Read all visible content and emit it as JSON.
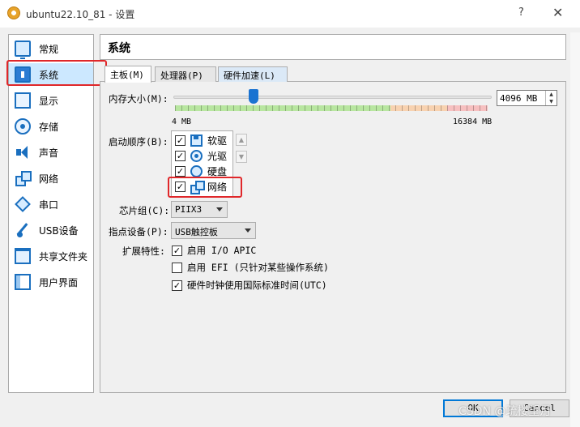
{
  "window": {
    "title": "ubuntu22.10_81 - 设置",
    "help_glyph": "?",
    "close_glyph": "✕"
  },
  "sidebar": {
    "items": [
      {
        "label": "常规",
        "icon": "general-icon"
      },
      {
        "label": "系统",
        "icon": "system-icon"
      },
      {
        "label": "显示",
        "icon": "display-icon"
      },
      {
        "label": "存储",
        "icon": "storage-icon"
      },
      {
        "label": "声音",
        "icon": "audio-icon"
      },
      {
        "label": "网络",
        "icon": "network-icon"
      },
      {
        "label": "串口",
        "icon": "serial-port-icon"
      },
      {
        "label": "USB设备",
        "icon": "usb-icon"
      },
      {
        "label": "共享文件夹",
        "icon": "shared-folder-icon"
      },
      {
        "label": "用户界面",
        "icon": "user-interface-icon"
      }
    ],
    "selected": "系统"
  },
  "panel": {
    "title": "系统",
    "tabs": [
      {
        "label": "主板(M)"
      },
      {
        "label": "处理器(P)"
      },
      {
        "label": "硬件加速(L)"
      }
    ],
    "active_tab": "主板(M)"
  },
  "motherboard": {
    "memory": {
      "label": "内存大小(M):",
      "value": "4096 MB",
      "value_mb": 4096,
      "min_label": "4 MB",
      "max_label": "16384 MB",
      "min_mb": 4,
      "max_mb": 16384
    },
    "boot_order": {
      "label": "启动顺序(B):",
      "items": [
        {
          "label": "软驱",
          "checked": true,
          "icon": "floppy-icon"
        },
        {
          "label": "光驱",
          "checked": true,
          "icon": "optical-icon"
        },
        {
          "label": "硬盘",
          "checked": true,
          "icon": "hard-disk-icon"
        },
        {
          "label": "网络",
          "checked": true,
          "icon": "network-icon"
        }
      ]
    },
    "chipset": {
      "label": "芯片组(C):",
      "value": "PIIX3"
    },
    "pointing_device": {
      "label": "指点设备(P):",
      "value": "USB触控板"
    },
    "extended_features": {
      "label": "扩展特性:",
      "items": [
        {
          "label": "启用 I/O APIC",
          "checked": true
        },
        {
          "label": "启用 EFI (只针对某些操作系统)",
          "checked": false
        },
        {
          "label": "硬件时钟使用国际标准时间(UTC)",
          "checked": true
        }
      ]
    }
  },
  "footer": {
    "ok_label": "OK",
    "cancel_label": "Cancel"
  },
  "watermark": "CSDN @疏楼望月",
  "colors": {
    "highlight": "#e0272a",
    "accent": "#0078d7",
    "selected_bg": "#cce8ff"
  }
}
